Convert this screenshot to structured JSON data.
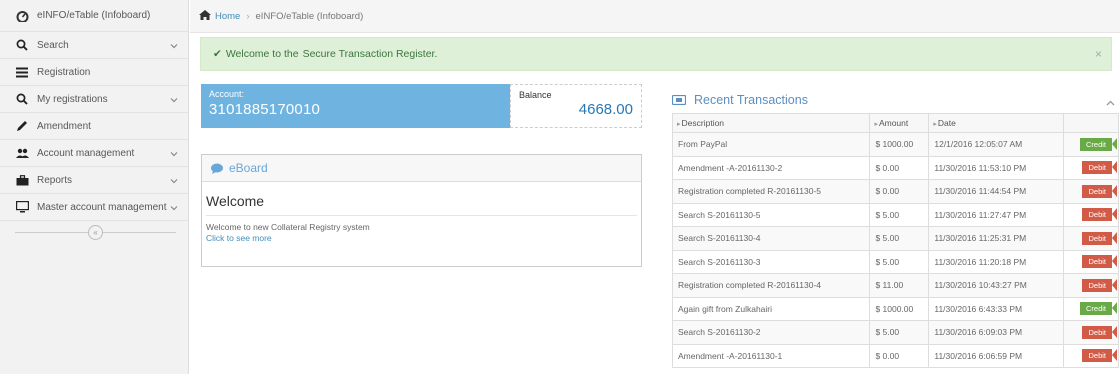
{
  "sidebar": {
    "brand": "eINFO/eTable (Infoboard)",
    "items": [
      {
        "label": "Search",
        "icon": "search-icon",
        "chevron": true
      },
      {
        "label": "Registration",
        "icon": "list-icon",
        "chevron": false
      },
      {
        "label": "My registrations",
        "icon": "search-icon",
        "chevron": true
      },
      {
        "label": "Amendment",
        "icon": "pencil-icon",
        "chevron": false
      },
      {
        "label": "Account management",
        "icon": "users-icon",
        "chevron": true
      },
      {
        "label": "Reports",
        "icon": "briefcase-icon",
        "chevron": true
      },
      {
        "label": "Master account management",
        "icon": "monitor-icon",
        "chevron": true
      }
    ],
    "collapse_symbol": "«"
  },
  "breadcrumb": {
    "home": "Home",
    "separator": "›",
    "current": "eINFO/eTable (Infoboard)"
  },
  "alert": {
    "check": "✔",
    "prefix": "Welcome to the",
    "strong": "Secure Transaction Register.",
    "close": "×"
  },
  "account": {
    "label": "Account:",
    "number": "3101885170010",
    "balance_label": "Balance",
    "balance": "4668.00"
  },
  "eboard": {
    "title": "eBoard",
    "heading": "Welcome",
    "description": "Welcome to new Collateral Registry system",
    "more_link": "Click to see more"
  },
  "transactions": {
    "title": "Recent Transactions",
    "columns": [
      "Description",
      "Amount",
      "Date"
    ],
    "rows": [
      {
        "description": "From PayPal",
        "amount": "$ 1000.00",
        "date": "12/1/2016 12:05:07 AM",
        "type": "Credit"
      },
      {
        "description": "Amendment -A-20161130-2",
        "amount": "$ 0.00",
        "date": "11/30/2016 11:53:10 PM",
        "type": "Debit"
      },
      {
        "description": "Registration completed R-20161130-5",
        "amount": "$ 0.00",
        "date": "11/30/2016 11:44:54 PM",
        "type": "Debit"
      },
      {
        "description": "Search S-20161130-5",
        "amount": "$ 5.00",
        "date": "11/30/2016 11:27:47 PM",
        "type": "Debit"
      },
      {
        "description": "Search S-20161130-4",
        "amount": "$ 5.00",
        "date": "11/30/2016 11:25:31 PM",
        "type": "Debit"
      },
      {
        "description": "Search S-20161130-3",
        "amount": "$ 5.00",
        "date": "11/30/2016 11:20:18 PM",
        "type": "Debit"
      },
      {
        "description": "Registration completed R-20161130-4",
        "amount": "$ 11.00",
        "date": "11/30/2016 10:43:27 PM",
        "type": "Debit"
      },
      {
        "description": "Again gift from Zulkahairi",
        "amount": "$ 1000.00",
        "date": "11/30/2016 6:43:33 PM",
        "type": "Credit"
      },
      {
        "description": "Search S-20161130-2",
        "amount": "$ 5.00",
        "date": "11/30/2016 6:09:03 PM",
        "type": "Debit"
      },
      {
        "description": "Amendment -A-20161130-1",
        "amount": "$ 0.00",
        "date": "11/30/2016 6:06:59 PM",
        "type": "Debit"
      }
    ]
  },
  "colors": {
    "accent": "#6fb3e0",
    "link": "#438eb9",
    "credit": "#69aa46",
    "debit": "#d15b47",
    "alert_bg": "#dff0d8"
  }
}
